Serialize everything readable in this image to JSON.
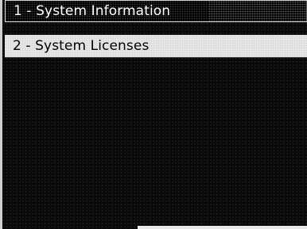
{
  "menu": {
    "items": [
      {
        "label": "1 - System Information",
        "selected": true
      },
      {
        "label": "2 - System Licenses",
        "selected": false
      }
    ]
  },
  "colors": {
    "background": "#000000",
    "selected_text": "#ffffff",
    "item_background": "#e6e6e6",
    "item_text": "#000000"
  }
}
